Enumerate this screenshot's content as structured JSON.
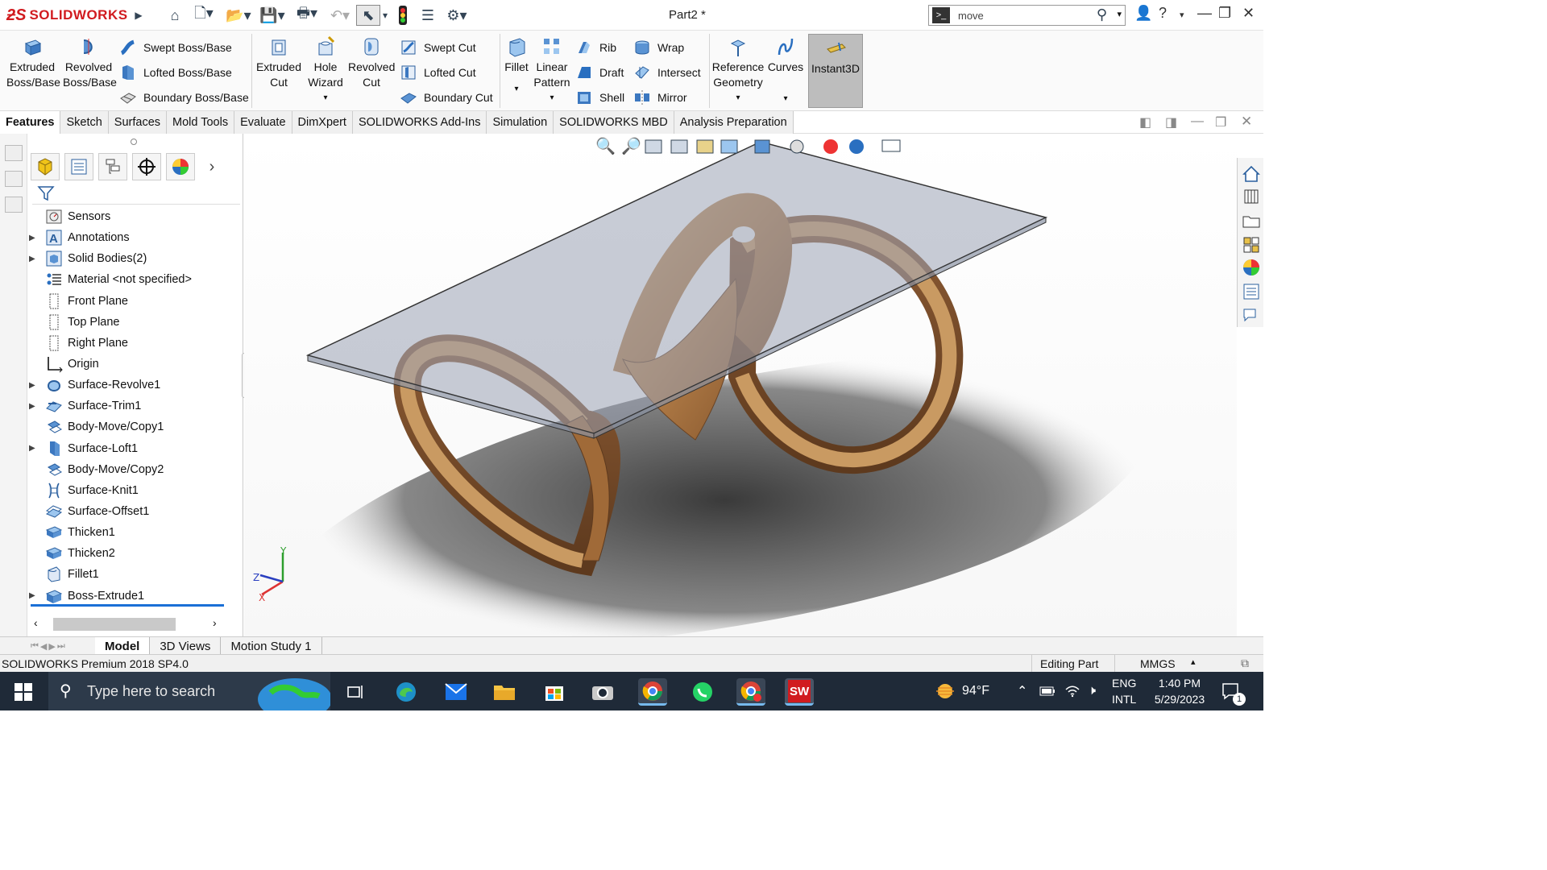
{
  "app": {
    "name": "SOLIDWORKS",
    "document_title": "Part2 *"
  },
  "search": {
    "value": "move"
  },
  "command_manager": {
    "extruded_boss": "Extruded Boss/Base",
    "revolved_boss": "Revolved Boss/Base",
    "swept_boss": "Swept Boss/Base",
    "lofted_boss": "Lofted Boss/Base",
    "boundary_boss": "Boundary Boss/Base",
    "extruded_cut": "Extruded Cut",
    "hole_wizard": "Hole Wizard",
    "revolved_cut": "Revolved Cut",
    "swept_cut": "Swept Cut",
    "lofted_cut": "Lofted Cut",
    "boundary_cut": "Boundary Cut",
    "fillet": "Fillet",
    "linear_pattern": "Linear Pattern",
    "rib": "Rib",
    "draft": "Draft",
    "shell": "Shell",
    "wrap": "Wrap",
    "intersect": "Intersect",
    "mirror": "Mirror",
    "reference_geometry": "Reference Geometry",
    "curves": "Curves",
    "instant3d": "Instant3D"
  },
  "tabs": [
    {
      "label": "Features",
      "active": true
    },
    {
      "label": "Sketch"
    },
    {
      "label": "Surfaces"
    },
    {
      "label": "Mold Tools"
    },
    {
      "label": "Evaluate"
    },
    {
      "label": "DimXpert"
    },
    {
      "label": "SOLIDWORKS Add-Ins"
    },
    {
      "label": "Simulation"
    },
    {
      "label": "SOLIDWORKS MBD"
    },
    {
      "label": "Analysis Preparation"
    }
  ],
  "tree": [
    {
      "label": "Sensors",
      "icon": "sensors-icon",
      "expandable": false
    },
    {
      "label": "Annotations",
      "icon": "annotations-icon",
      "expandable": true
    },
    {
      "label": "Solid Bodies(2)",
      "icon": "solid-bodies-icon",
      "expandable": true
    },
    {
      "label": "Material <not specified>",
      "icon": "material-icon",
      "expandable": false
    },
    {
      "label": "Front Plane",
      "icon": "plane-icon",
      "expandable": false
    },
    {
      "label": "Top Plane",
      "icon": "plane-icon",
      "expandable": false
    },
    {
      "label": "Right Plane",
      "icon": "plane-icon",
      "expandable": false
    },
    {
      "label": "Origin",
      "icon": "origin-icon",
      "expandable": false
    },
    {
      "label": "Surface-Revolve1",
      "icon": "surface-revolve-icon",
      "expandable": true
    },
    {
      "label": "Surface-Trim1",
      "icon": "surface-trim-icon",
      "expandable": true
    },
    {
      "label": "Body-Move/Copy1",
      "icon": "body-move-icon",
      "expandable": false
    },
    {
      "label": "Surface-Loft1",
      "icon": "surface-loft-icon",
      "expandable": true
    },
    {
      "label": "Body-Move/Copy2",
      "icon": "body-move-icon",
      "expandable": false
    },
    {
      "label": "Surface-Knit1",
      "icon": "surface-knit-icon",
      "expandable": false
    },
    {
      "label": "Surface-Offset1",
      "icon": "surface-offset-icon",
      "expandable": false
    },
    {
      "label": "Thicken1",
      "icon": "thicken-icon",
      "expandable": false
    },
    {
      "label": "Thicken2",
      "icon": "thicken-icon",
      "expandable": false
    },
    {
      "label": "Fillet1",
      "icon": "fillet-icon",
      "expandable": false
    },
    {
      "label": "Boss-Extrude1",
      "icon": "boss-extrude-icon",
      "expandable": true
    }
  ],
  "bottom_tabs": [
    {
      "label": "Model",
      "active": true
    },
    {
      "label": "3D Views"
    },
    {
      "label": "Motion Study 1"
    }
  ],
  "status": {
    "product": "SOLIDWORKS Premium 2018 SP4.0",
    "mode": "Editing Part",
    "units": "MMGS"
  },
  "taskbar": {
    "search_placeholder": "Type here to search",
    "weather": "94°F",
    "lang_top": "ENG",
    "lang_bottom": "INTL",
    "time": "1:40 PM",
    "date": "5/29/2023",
    "notification_count": "1"
  },
  "triad": {
    "x": "X",
    "y": "Y",
    "z": "Z"
  }
}
